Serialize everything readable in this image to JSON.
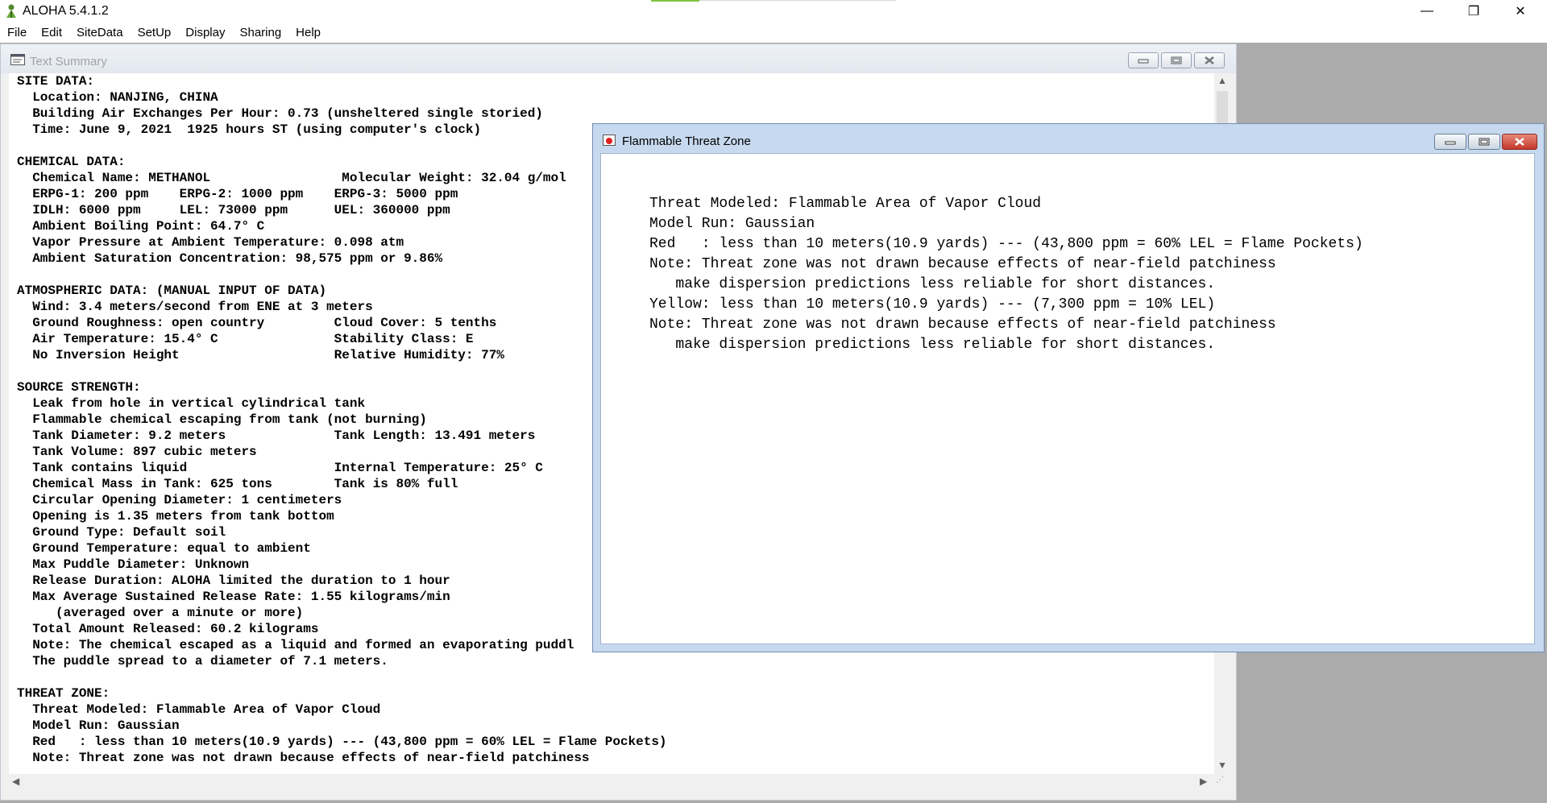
{
  "app": {
    "title": "ALOHA 5.4.1.2",
    "window_controls": {
      "minimize": "—",
      "restore": "❐",
      "close": "✕"
    }
  },
  "menu": [
    "File",
    "Edit",
    "SiteData",
    "SetUp",
    "Display",
    "Sharing",
    "Help"
  ],
  "text_summary": {
    "title": "Text Summary",
    "lines": [
      "SITE DATA:",
      "  Location: NANJING, CHINA",
      "  Building Air Exchanges Per Hour: 0.73 (unsheltered single storied)",
      "  Time: June 9, 2021  1925 hours ST (using computer's clock)",
      "",
      "CHEMICAL DATA:",
      "  Chemical Name: METHANOL                 Molecular Weight: 32.04 g/mol",
      "  ERPG-1: 200 ppm    ERPG-2: 1000 ppm    ERPG-3: 5000 ppm",
      "  IDLH: 6000 ppm     LEL: 73000 ppm      UEL: 360000 ppm",
      "  Ambient Boiling Point: 64.7° C",
      "  Vapor Pressure at Ambient Temperature: 0.098 atm",
      "  Ambient Saturation Concentration: 98,575 ppm or 9.86%",
      "",
      "ATMOSPHERIC DATA: (MANUAL INPUT OF DATA)",
      "  Wind: 3.4 meters/second from ENE at 3 meters",
      "  Ground Roughness: open country         Cloud Cover: 5 tenths",
      "  Air Temperature: 15.4° C               Stability Class: E",
      "  No Inversion Height                    Relative Humidity: 77%",
      "",
      "SOURCE STRENGTH:",
      "  Leak from hole in vertical cylindrical tank",
      "  Flammable chemical escaping from tank (not burning)",
      "  Tank Diameter: 9.2 meters              Tank Length: 13.491 meters",
      "  Tank Volume: 897 cubic meters",
      "  Tank contains liquid                   Internal Temperature: 25° C",
      "  Chemical Mass in Tank: 625 tons        Tank is 80% full",
      "  Circular Opening Diameter: 1 centimeters",
      "  Opening is 1.35 meters from tank bottom",
      "  Ground Type: Default soil",
      "  Ground Temperature: equal to ambient",
      "  Max Puddle Diameter: Unknown",
      "  Release Duration: ALOHA limited the duration to 1 hour",
      "  Max Average Sustained Release Rate: 1.55 kilograms/min",
      "     (averaged over a minute or more)",
      "  Total Amount Released: 60.2 kilograms",
      "  Note: The chemical escaped as a liquid and formed an evaporating puddl",
      "  The puddle spread to a diameter of 7.1 meters.",
      "",
      "THREAT ZONE:",
      "  Threat Modeled: Flammable Area of Vapor Cloud",
      "  Model Run: Gaussian",
      "  Red   : less than 10 meters(10.9 yards) --- (43,800 ppm = 60% LEL = Flame Pockets)",
      "  Note: Threat zone was not drawn because effects of near-field patchiness"
    ]
  },
  "flammable_threat_zone": {
    "title": "Flammable Threat Zone",
    "lines": [
      "Threat Modeled: Flammable Area of Vapor Cloud",
      "Model Run: Gaussian",
      "Red   : less than 10 meters(10.9 yards) --- (43,800 ppm = 60% LEL = Flame Pockets)",
      "Note: Threat zone was not drawn because effects of near-field patchiness",
      "   make dispersion predictions less reliable for short distances.",
      "Yellow: less than 10 meters(10.9 yards) --- (7,300 ppm = 10% LEL)",
      "Note: Threat zone was not drawn because effects of near-field patchiness",
      "   make dispersion predictions less reliable for short distances."
    ]
  }
}
